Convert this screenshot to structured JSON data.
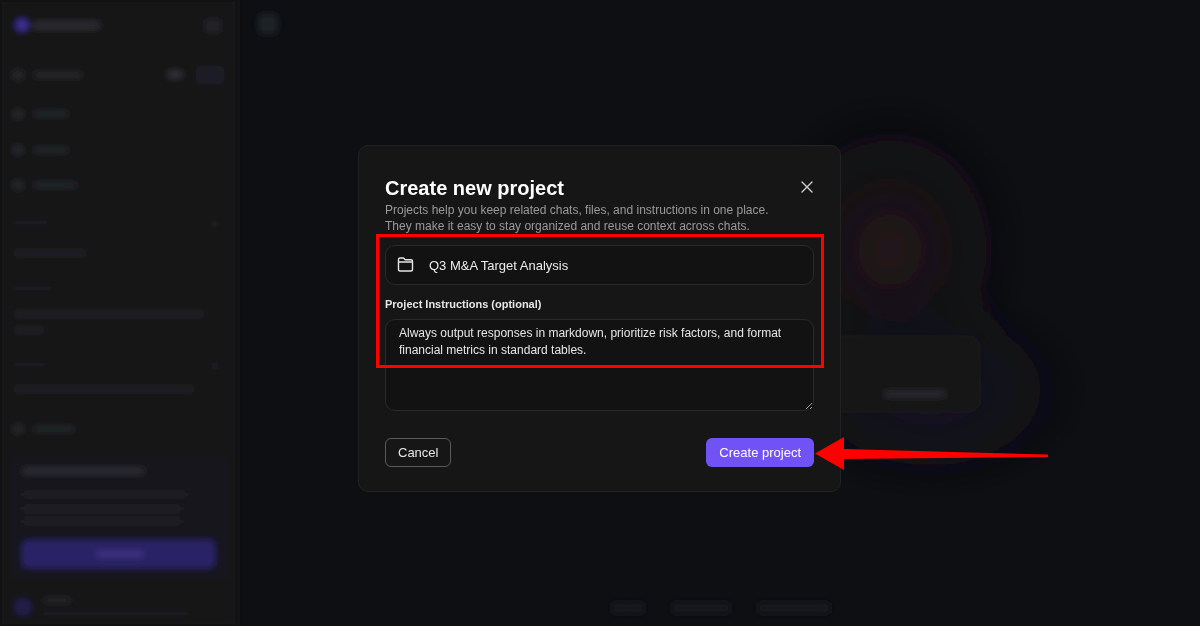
{
  "backdrop": {
    "blurred": true
  },
  "dialog": {
    "title": "Create new project",
    "description": "Projects help you keep related chats, files, and instructions in one place. They make it easy to stay organized and reuse context across chats.",
    "highlighted": true,
    "name_field": {
      "value": "Q3 M&A Target Analysis"
    },
    "instructions": {
      "label": "Project Instructions (optional)",
      "value": "Always output responses in markdown, prioritize risk factors, and format financial metrics in standard tables."
    },
    "buttons": [
      {
        "kind": "secondary",
        "label": "Cancel",
        "pointed": false
      },
      {
        "kind": "primary",
        "label": "Create project",
        "pointed": true
      }
    ]
  }
}
